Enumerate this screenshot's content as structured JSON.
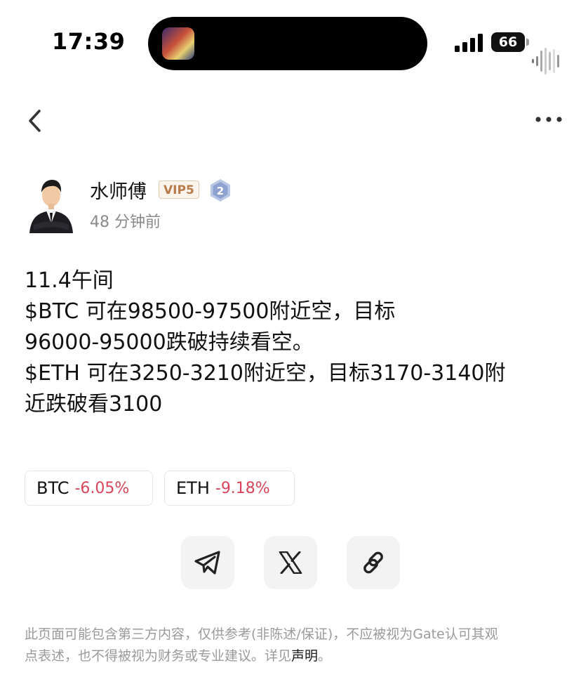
{
  "status_bar": {
    "time": "17:39",
    "battery": "66"
  },
  "nav": {
    "back_icon": "chevron-left-icon",
    "more_icon": "more-horizontal-icon"
  },
  "author": {
    "name": "水师傅",
    "vip_badge": "VIP5",
    "level": "2",
    "posted_ago": "48 分钟前"
  },
  "post": {
    "lines": [
      "11.4午间",
      "$BTC 可在98500-97500附近空，目标",
      "96000-95000跌破持续看空。",
      "$ETH 可在3250-3210附近空，目标3170-3140附",
      "近跌破看3100"
    ]
  },
  "tickers": [
    {
      "symbol": "BTC",
      "change": "-6.05%"
    },
    {
      "symbol": "ETH",
      "change": "-9.18%"
    }
  ],
  "share": {
    "telegram_icon": "telegram-icon",
    "x_icon": "x-icon",
    "link_icon": "link-icon"
  },
  "disclaimer": {
    "text_line1": "此页面可能包含第三方内容，仅供参考(非陈述/保证)，不应被视为Gate认可其观",
    "text_line2": "点表述，也不得被视为财务或专业建议。详见",
    "link": "声明",
    "end": "。"
  },
  "colors": {
    "negative": "#d9445b",
    "vip": "#b87b4a"
  }
}
